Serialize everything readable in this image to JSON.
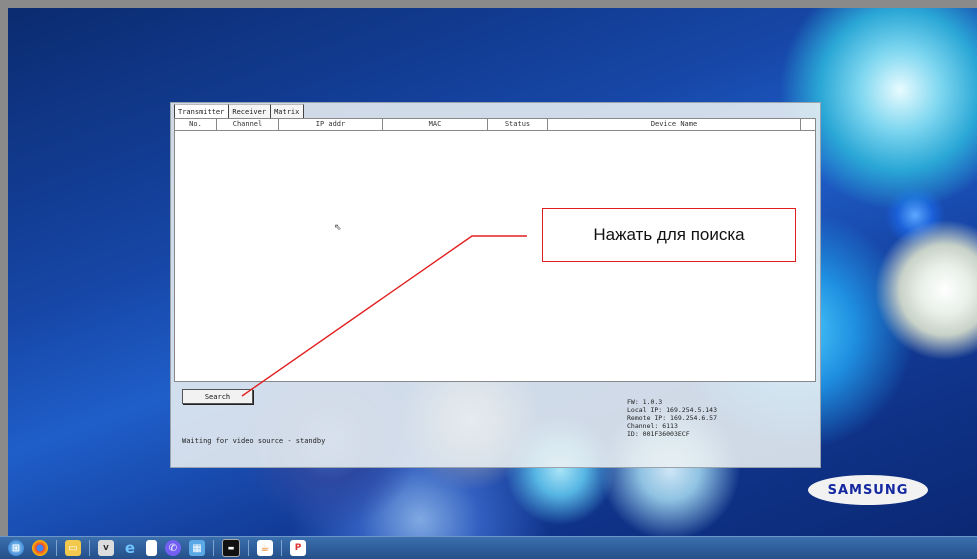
{
  "app": {
    "tabs": [
      {
        "label": "Transmitter"
      },
      {
        "label": "Receiver"
      },
      {
        "label": "Matrix"
      }
    ],
    "table": {
      "columns": [
        {
          "label": "No."
        },
        {
          "label": "Channel"
        },
        {
          "label": "IP addr"
        },
        {
          "label": "MAC"
        },
        {
          "label": "Status"
        },
        {
          "label": "Device Name"
        }
      ],
      "rows": []
    },
    "search_label": "Search",
    "status_text": "Waiting for video source - standby",
    "info": {
      "fw": "FW: 1.0.3",
      "local_ip": "Local IP: 169.254.5.143",
      "remote_ip": "Remote IP: 169.254.6.57",
      "channel": "Channel: 6113",
      "id": "ID: 001F36003ECF"
    }
  },
  "callout": {
    "text": "Нажать для поиска",
    "color": "#e02020"
  },
  "wallpaper": {
    "logo_text": "SAMSUNG",
    "logo_color": "#1428a0"
  },
  "taskbar": {
    "icons": [
      "start-orb-icon",
      "chrome-icon",
      "file-explorer-icon",
      "vnc-icon",
      "internet-explorer-icon",
      "document-icon",
      "viber-icon",
      "control-panel-icon",
      "terminal-icon",
      "java-icon",
      "paint-icon"
    ]
  }
}
